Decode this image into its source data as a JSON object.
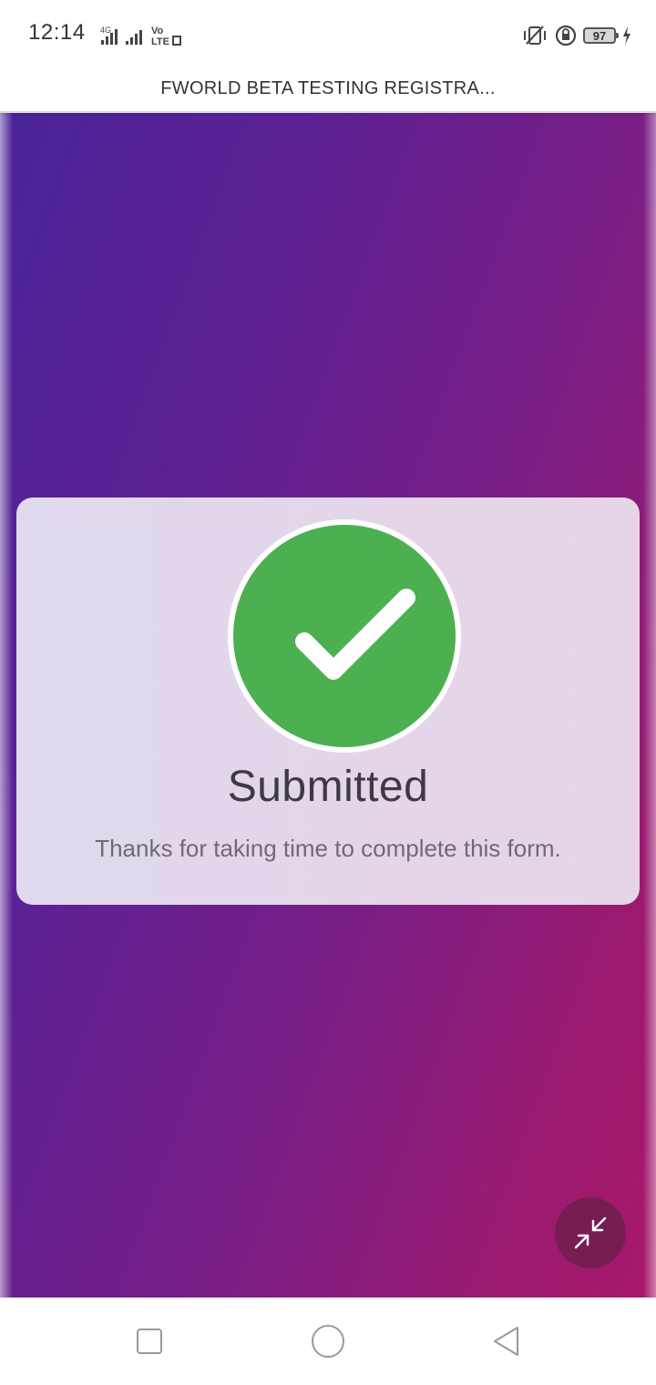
{
  "status_bar": {
    "time": "12:14",
    "network_label": "4G",
    "volte_label": "Vo LTE",
    "battery_level": "97",
    "icons": [
      "signal-bars-icon",
      "vibrate-icon",
      "rotation-lock-icon",
      "battery-icon",
      "charging-icon"
    ]
  },
  "header": {
    "title": "FWORLD BETA TESTING REGISTRA..."
  },
  "confirmation": {
    "icon": "checkmark-icon",
    "heading": "Submitted",
    "message": "Thanks for taking time to complete this form."
  },
  "fab": {
    "icon": "minimize-arrows-icon"
  },
  "nav_bar": {
    "icons": [
      "recent-apps-icon",
      "home-icon",
      "back-icon"
    ]
  },
  "colors": {
    "success": "#4caf50",
    "gradient_start": "#4a2499",
    "gradient_end": "#a8186a"
  }
}
